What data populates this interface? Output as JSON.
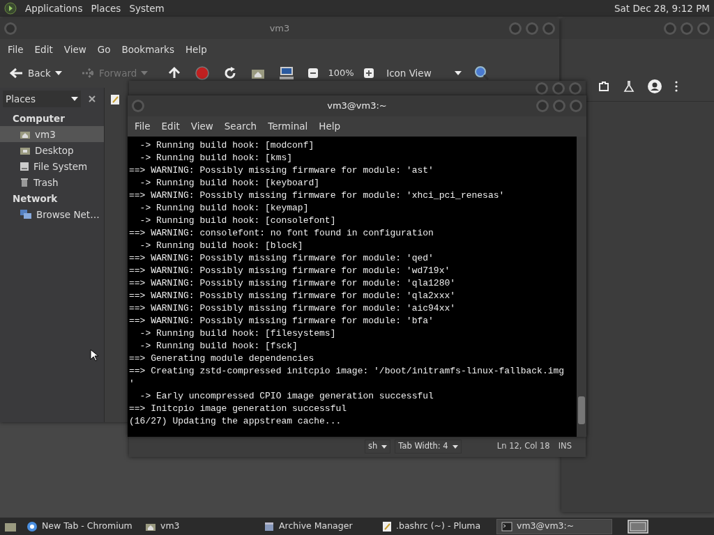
{
  "top_panel": {
    "menus": [
      "Applications",
      "Places",
      "System"
    ],
    "clock": "Sat Dec 28,  9:12 PM"
  },
  "file_manager": {
    "title": "vm3",
    "menu": [
      "File",
      "Edit",
      "View",
      "Go",
      "Bookmarks",
      "Help"
    ],
    "toolbar": [
      {
        "kind": "back",
        "label": "Back",
        "disabled": false
      },
      {
        "kind": "forward",
        "label": "Forward",
        "disabled": true
      },
      {
        "kind": "up"
      },
      {
        "kind": "stop"
      },
      {
        "kind": "reload"
      },
      {
        "kind": "home"
      },
      {
        "kind": "computer"
      },
      {
        "kind": "zoom",
        "label": "100%"
      },
      {
        "kind": "view",
        "label": "Icon View"
      },
      {
        "kind": "search"
      }
    ],
    "sidebar": {
      "header": "Places",
      "sections": [
        {
          "title": "Computer",
          "items": [
            {
              "label": "vm3",
              "kind": "home",
              "selected": true
            },
            {
              "label": "Desktop",
              "kind": "desktop",
              "selected": false
            },
            {
              "label": "File System",
              "kind": "drive",
              "selected": false
            },
            {
              "label": "Trash",
              "kind": "trash",
              "selected": false
            }
          ]
        },
        {
          "title": "Network",
          "items": [
            {
              "label": "Browse Net…",
              "kind": "network",
              "selected": false
            }
          ]
        }
      ]
    }
  },
  "terminal": {
    "title": "vm3@vm3:~",
    "menu": [
      "File",
      "Edit",
      "View",
      "Search",
      "Terminal",
      "Help"
    ],
    "lines": [
      "  -> Running build hook: [modconf]",
      "  -> Running build hook: [kms]",
      "==> WARNING: Possibly missing firmware for module: 'ast'",
      "  -> Running build hook: [keyboard]",
      "==> WARNING: Possibly missing firmware for module: 'xhci_pci_renesas'",
      "  -> Running build hook: [keymap]",
      "  -> Running build hook: [consolefont]",
      "==> WARNING: consolefont: no font found in configuration",
      "  -> Running build hook: [block]",
      "==> WARNING: Possibly missing firmware for module: 'qed'",
      "==> WARNING: Possibly missing firmware for module: 'wd719x'",
      "==> WARNING: Possibly missing firmware for module: 'qla1280'",
      "==> WARNING: Possibly missing firmware for module: 'qla2xxx'",
      "==> WARNING: Possibly missing firmware for module: 'aic94xx'",
      "==> WARNING: Possibly missing firmware for module: 'bfa'",
      "  -> Running build hook: [filesystems]",
      "  -> Running build hook: [fsck]",
      "==> Generating module dependencies",
      "==> Creating zstd-compressed initcpio image: '/boot/initramfs-linux-fallback.img",
      "'",
      "  -> Early uncompressed CPIO image generation successful",
      "==> Initcpio image generation successful",
      "(16/27) Updating the appstream cache..."
    ]
  },
  "editor_status": {
    "language": "sh",
    "tab_width": "Tab Width:  4",
    "position": "Ln 12, Col 18",
    "mode": "INS"
  },
  "taskbar": [
    {
      "label": "New Tab - Chromium",
      "kind": "browser",
      "selected": false
    },
    {
      "label": "vm3",
      "kind": "folder",
      "selected": false
    },
    {
      "label": "Archive Manager",
      "kind": "archive",
      "selected": false
    },
    {
      "label": ".bashrc (~) - Pluma",
      "kind": "editor",
      "selected": false
    },
    {
      "label": "vm3@vm3:~",
      "kind": "terminal",
      "selected": true
    }
  ]
}
